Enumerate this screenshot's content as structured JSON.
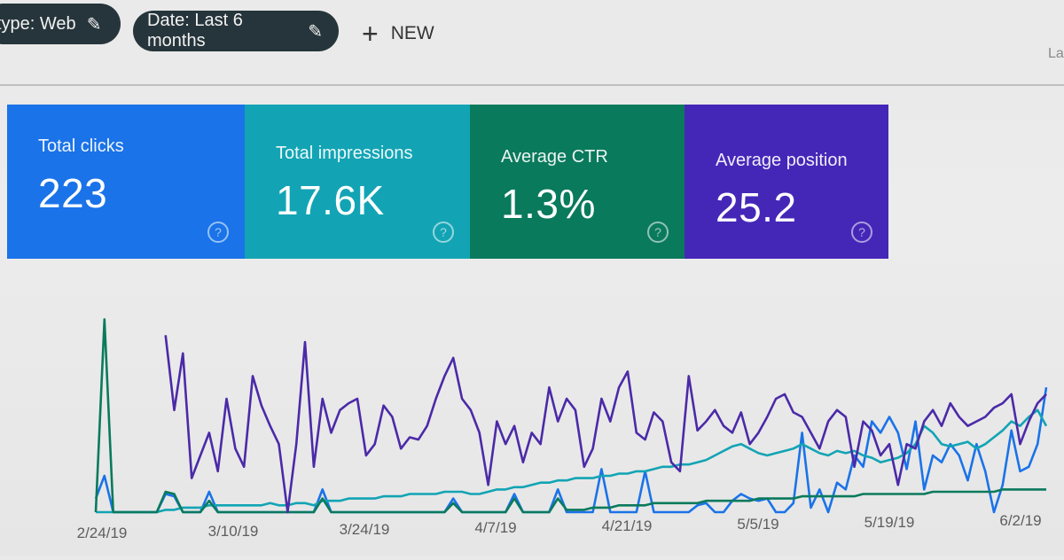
{
  "filters": {
    "type_chip": "type: Web",
    "date_chip": "Date: Last 6 months",
    "edit_icon": "pencil-icon",
    "new_button": "NEW",
    "new_icon": "plus-icon",
    "right_cut_text": "La"
  },
  "cards": [
    {
      "label": "Total clicks",
      "value": "223",
      "color": "#1a73e8",
      "help_icon": "help-circle-icon"
    },
    {
      "label": "Total impressions",
      "value": "17.6K",
      "color": "#12a4b4",
      "help_icon": "help-circle-icon"
    },
    {
      "label": "Average CTR",
      "value": "1.3%",
      "color": "#0a7a5c",
      "help_icon": "help-circle-icon"
    },
    {
      "label": "Average position",
      "value": "25.2",
      "color": "#4527b8",
      "help_icon": "help-circle-icon"
    }
  ],
  "chart_data": {
    "type": "line",
    "title": "",
    "xlabel": "",
    "ylabel": "",
    "ylim": [
      0,
      100
    ],
    "grid": false,
    "legend": "none",
    "x_ticks": [
      "2/24/19",
      "3/10/19",
      "3/24/19",
      "4/7/19",
      "4/21/19",
      "5/5/19",
      "5/19/19",
      "6/2/19"
    ],
    "x_count": 110,
    "series": [
      {
        "name": "Total clicks",
        "color": "#1a73e8",
        "values": [
          6,
          16,
          0,
          0,
          0,
          0,
          0,
          0,
          8,
          7,
          0,
          0,
          0,
          9,
          0,
          0,
          0,
          0,
          0,
          0,
          0,
          0,
          0,
          0,
          0,
          0,
          10,
          0,
          0,
          0,
          0,
          0,
          0,
          0,
          0,
          0,
          0,
          0,
          0,
          0,
          0,
          6,
          0,
          0,
          0,
          0,
          0,
          0,
          8,
          0,
          0,
          0,
          0,
          10,
          0,
          0,
          0,
          0,
          19,
          0,
          0,
          0,
          0,
          18,
          0,
          0,
          0,
          0,
          0,
          3,
          4,
          0,
          0,
          5,
          8,
          6,
          5,
          6,
          0,
          0,
          4,
          35,
          2,
          10,
          0,
          13,
          10,
          25,
          20,
          40,
          35,
          42,
          35,
          19,
          40,
          10,
          25,
          22,
          30,
          25,
          14,
          30,
          18,
          0,
          12,
          36,
          18,
          20,
          30,
          55
        ]
      },
      {
        "name": "Total impressions",
        "color": "#12a4b4",
        "values": [
          0,
          0,
          0,
          0,
          0,
          0,
          0,
          0,
          1,
          1,
          2,
          2,
          2,
          3,
          3,
          3,
          3,
          3,
          3,
          3,
          4,
          3,
          3,
          4,
          4,
          3,
          5,
          5,
          5,
          6,
          6,
          6,
          6,
          7,
          7,
          7,
          8,
          8,
          8,
          8,
          9,
          9,
          9,
          8,
          8,
          9,
          10,
          10,
          11,
          11,
          12,
          13,
          13,
          14,
          14,
          15,
          15,
          15,
          16,
          16,
          17,
          17,
          18,
          18,
          19,
          20,
          20,
          21,
          21,
          22,
          23,
          25,
          27,
          29,
          30,
          28,
          26,
          25,
          26,
          27,
          28,
          30,
          28,
          26,
          25,
          27,
          26,
          27,
          25,
          24,
          22,
          23,
          24,
          26,
          30,
          38,
          35,
          30,
          29,
          30,
          31,
          28,
          30,
          33,
          36,
          40,
          38,
          42,
          45,
          38
        ]
      },
      {
        "name": "Average CTR",
        "color": "#0a7a5c",
        "values": [
          0,
          85,
          0,
          0,
          0,
          0,
          0,
          0,
          9,
          8,
          0,
          0,
          0,
          5,
          0,
          0,
          0,
          0,
          0,
          0,
          0,
          0,
          0,
          0,
          0,
          0,
          6,
          0,
          0,
          0,
          0,
          0,
          0,
          0,
          0,
          0,
          0,
          0,
          0,
          0,
          0,
          4,
          0,
          0,
          0,
          0,
          0,
          0,
          6,
          0,
          0,
          0,
          0,
          6,
          1,
          1,
          1,
          2,
          2,
          2,
          3,
          3,
          3,
          3,
          4,
          4,
          4,
          4,
          4,
          4,
          5,
          5,
          5,
          5,
          5,
          5,
          6,
          6,
          6,
          6,
          6,
          7,
          7,
          7,
          7,
          7,
          7,
          7,
          8,
          8,
          8,
          8,
          8,
          8,
          8,
          8,
          9,
          9,
          9,
          9,
          9,
          9,
          9,
          9,
          10,
          10,
          10,
          10,
          10,
          10
        ]
      },
      {
        "name": "Average position",
        "color": "#4b2aa8",
        "values": [
          null,
          null,
          null,
          null,
          null,
          null,
          null,
          null,
          78,
          45,
          70,
          15,
          25,
          35,
          18,
          50,
          28,
          20,
          60,
          47,
          38,
          30,
          0,
          30,
          75,
          20,
          50,
          35,
          45,
          48,
          50,
          25,
          30,
          47,
          42,
          28,
          33,
          32,
          38,
          50,
          60,
          68,
          50,
          45,
          35,
          12,
          40,
          30,
          38,
          22,
          35,
          30,
          55,
          40,
          50,
          45,
          20,
          28,
          50,
          40,
          55,
          62,
          35,
          32,
          44,
          40,
          22,
          18,
          60,
          36,
          40,
          45,
          38,
          35,
          44,
          30,
          35,
          42,
          50,
          52,
          44,
          42,
          35,
          28,
          40,
          45,
          42,
          20,
          40,
          36,
          25,
          30,
          12,
          30,
          28,
          40,
          45,
          38,
          48,
          42,
          38,
          40,
          42,
          46,
          48,
          52,
          30,
          40,
          48,
          52
        ]
      }
    ]
  }
}
